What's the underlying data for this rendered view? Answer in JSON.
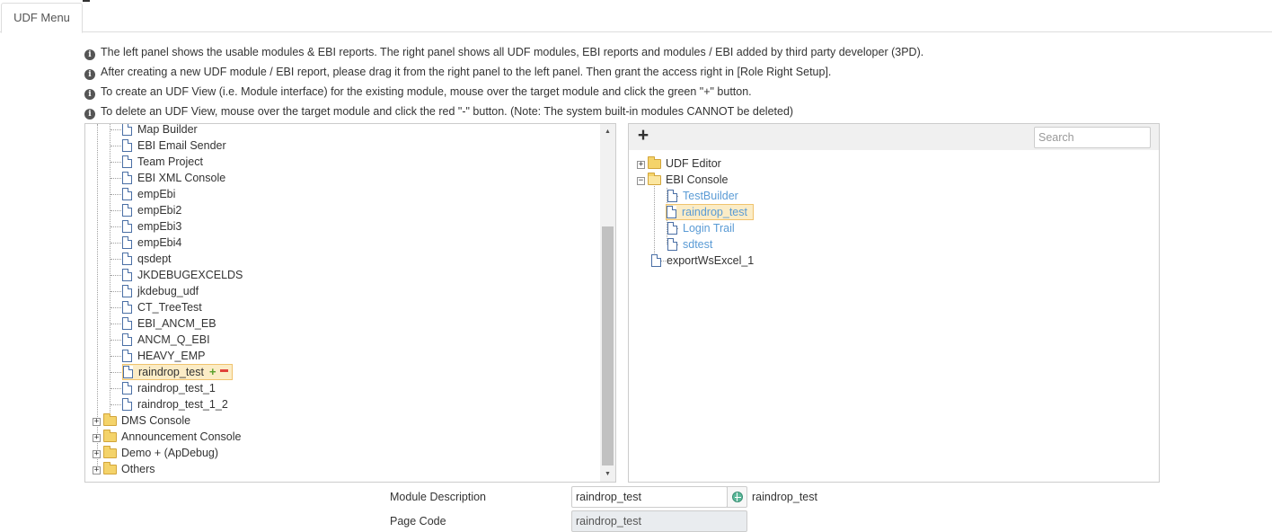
{
  "tabs": [
    {
      "label": "UDF Menu",
      "active": true
    }
  ],
  "info_lines": [
    "The left panel shows the usable modules & EBI reports. The right panel shows all UDF modules, EBI reports and modules / EBI added by third party developer (3PD).",
    "After creating a new UDF module / EBI report, please drag it from the right panel to the left panel. Then grant the access right in [Role Right Setup].",
    "To create an UDF View (i.e. Module interface) for the existing module, mouse over the target module and click the green \"+\" button.",
    "To delete an UDF View, mouse over the target module and click the red \"-\" button. (Note: The system built-in modules CANNOT be deleted)"
  ],
  "left_tree": {
    "children": [
      "Map Builder",
      "EBI Email Sender",
      "Team Project",
      "EBI XML Console",
      "empEbi",
      "empEbi2",
      "empEbi3",
      "empEbi4",
      "qsdept",
      "JKDEBUGEXCELDS",
      "jkdebug_udf",
      "CT_TreeTest",
      "EBI_ANCM_EB",
      "ANCM_Q_EBI",
      "HEAVY_EMP",
      "raindrop_test",
      "raindrop_test_1",
      "raindrop_test_1_2"
    ],
    "selected": "raindrop_test",
    "selected_actions": {
      "add": "+",
      "remove": "−"
    },
    "folders": [
      "DMS Console",
      "Announcement Console",
      "Demo + (ApDebug)",
      "Others"
    ],
    "expander_symbol": "+"
  },
  "right_panel": {
    "add_label": "+",
    "search_placeholder": "Search",
    "tree": [
      {
        "label": "UDF Editor",
        "type": "folder",
        "expanded": false
      },
      {
        "label": "EBI Console",
        "type": "folder",
        "expanded": true,
        "children": [
          "TestBuilder",
          "raindrop_test",
          "Login Trail",
          "sdtest"
        ],
        "selected": "raindrop_test"
      },
      {
        "label": "exportWsExcel_1",
        "type": "file"
      }
    ],
    "expander_collapsed": "+",
    "expander_expanded": "−"
  },
  "form": {
    "description_label": "Module Description",
    "description_value": "raindrop_test",
    "description_text": "raindrop_test",
    "page_code_label": "Page Code",
    "page_code_value": "raindrop_test"
  },
  "icons": {
    "info": "info-circle-icon",
    "file": "document-icon",
    "folder": "folder-icon",
    "globe": "globe-icon",
    "info_glyph": "i",
    "scroll_up_glyph": "▲",
    "scroll_down_glyph": "▼"
  },
  "colors": {
    "link": "#5a9bd5",
    "selection_bg": "#fbecc6",
    "add_green": "#5aa02c",
    "remove_red": "#e0413a"
  }
}
